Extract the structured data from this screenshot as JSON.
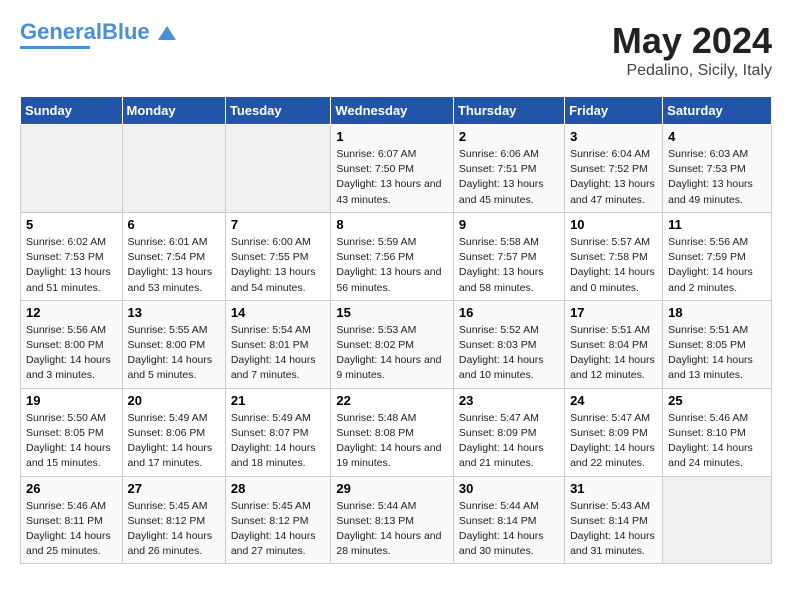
{
  "header": {
    "logo_line1": "General",
    "logo_line2": "Blue",
    "main_title": "May 2024",
    "subtitle": "Pedalino, Sicily, Italy"
  },
  "days_of_week": [
    "Sunday",
    "Monday",
    "Tuesday",
    "Wednesday",
    "Thursday",
    "Friday",
    "Saturday"
  ],
  "weeks": [
    [
      {
        "day": "",
        "info": ""
      },
      {
        "day": "",
        "info": ""
      },
      {
        "day": "",
        "info": ""
      },
      {
        "day": "1",
        "info": "Sunrise: 6:07 AM\nSunset: 7:50 PM\nDaylight: 13 hours\nand 43 minutes."
      },
      {
        "day": "2",
        "info": "Sunrise: 6:06 AM\nSunset: 7:51 PM\nDaylight: 13 hours\nand 45 minutes."
      },
      {
        "day": "3",
        "info": "Sunrise: 6:04 AM\nSunset: 7:52 PM\nDaylight: 13 hours\nand 47 minutes."
      },
      {
        "day": "4",
        "info": "Sunrise: 6:03 AM\nSunset: 7:53 PM\nDaylight: 13 hours\nand 49 minutes."
      }
    ],
    [
      {
        "day": "5",
        "info": "Sunrise: 6:02 AM\nSunset: 7:53 PM\nDaylight: 13 hours\nand 51 minutes."
      },
      {
        "day": "6",
        "info": "Sunrise: 6:01 AM\nSunset: 7:54 PM\nDaylight: 13 hours\nand 53 minutes."
      },
      {
        "day": "7",
        "info": "Sunrise: 6:00 AM\nSunset: 7:55 PM\nDaylight: 13 hours\nand 54 minutes."
      },
      {
        "day": "8",
        "info": "Sunrise: 5:59 AM\nSunset: 7:56 PM\nDaylight: 13 hours\nand 56 minutes."
      },
      {
        "day": "9",
        "info": "Sunrise: 5:58 AM\nSunset: 7:57 PM\nDaylight: 13 hours\nand 58 minutes."
      },
      {
        "day": "10",
        "info": "Sunrise: 5:57 AM\nSunset: 7:58 PM\nDaylight: 14 hours\nand 0 minutes."
      },
      {
        "day": "11",
        "info": "Sunrise: 5:56 AM\nSunset: 7:59 PM\nDaylight: 14 hours\nand 2 minutes."
      }
    ],
    [
      {
        "day": "12",
        "info": "Sunrise: 5:56 AM\nSunset: 8:00 PM\nDaylight: 14 hours\nand 3 minutes."
      },
      {
        "day": "13",
        "info": "Sunrise: 5:55 AM\nSunset: 8:00 PM\nDaylight: 14 hours\nand 5 minutes."
      },
      {
        "day": "14",
        "info": "Sunrise: 5:54 AM\nSunset: 8:01 PM\nDaylight: 14 hours\nand 7 minutes."
      },
      {
        "day": "15",
        "info": "Sunrise: 5:53 AM\nSunset: 8:02 PM\nDaylight: 14 hours\nand 9 minutes."
      },
      {
        "day": "16",
        "info": "Sunrise: 5:52 AM\nSunset: 8:03 PM\nDaylight: 14 hours\nand 10 minutes."
      },
      {
        "day": "17",
        "info": "Sunrise: 5:51 AM\nSunset: 8:04 PM\nDaylight: 14 hours\nand 12 minutes."
      },
      {
        "day": "18",
        "info": "Sunrise: 5:51 AM\nSunset: 8:05 PM\nDaylight: 14 hours\nand 13 minutes."
      }
    ],
    [
      {
        "day": "19",
        "info": "Sunrise: 5:50 AM\nSunset: 8:05 PM\nDaylight: 14 hours\nand 15 minutes."
      },
      {
        "day": "20",
        "info": "Sunrise: 5:49 AM\nSunset: 8:06 PM\nDaylight: 14 hours\nand 17 minutes."
      },
      {
        "day": "21",
        "info": "Sunrise: 5:49 AM\nSunset: 8:07 PM\nDaylight: 14 hours\nand 18 minutes."
      },
      {
        "day": "22",
        "info": "Sunrise: 5:48 AM\nSunset: 8:08 PM\nDaylight: 14 hours\nand 19 minutes."
      },
      {
        "day": "23",
        "info": "Sunrise: 5:47 AM\nSunset: 8:09 PM\nDaylight: 14 hours\nand 21 minutes."
      },
      {
        "day": "24",
        "info": "Sunrise: 5:47 AM\nSunset: 8:09 PM\nDaylight: 14 hours\nand 22 minutes."
      },
      {
        "day": "25",
        "info": "Sunrise: 5:46 AM\nSunset: 8:10 PM\nDaylight: 14 hours\nand 24 minutes."
      }
    ],
    [
      {
        "day": "26",
        "info": "Sunrise: 5:46 AM\nSunset: 8:11 PM\nDaylight: 14 hours\nand 25 minutes."
      },
      {
        "day": "27",
        "info": "Sunrise: 5:45 AM\nSunset: 8:12 PM\nDaylight: 14 hours\nand 26 minutes."
      },
      {
        "day": "28",
        "info": "Sunrise: 5:45 AM\nSunset: 8:12 PM\nDaylight: 14 hours\nand 27 minutes."
      },
      {
        "day": "29",
        "info": "Sunrise: 5:44 AM\nSunset: 8:13 PM\nDaylight: 14 hours\nand 28 minutes."
      },
      {
        "day": "30",
        "info": "Sunrise: 5:44 AM\nSunset: 8:14 PM\nDaylight: 14 hours\nand 30 minutes."
      },
      {
        "day": "31",
        "info": "Sunrise: 5:43 AM\nSunset: 8:14 PM\nDaylight: 14 hours\nand 31 minutes."
      },
      {
        "day": "",
        "info": ""
      }
    ]
  ]
}
